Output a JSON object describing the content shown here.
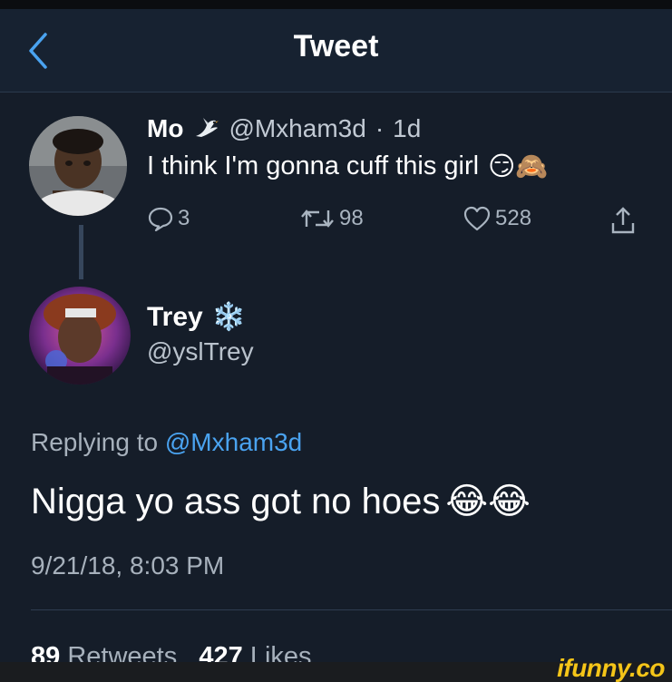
{
  "header": {
    "title": "Tweet"
  },
  "original_tweet": {
    "name": "Mo",
    "handle": "@Mxham3d",
    "separator": "·",
    "age": "1d",
    "text": "I think I'm gonna cuff this girl",
    "emoji": "😏🙈",
    "replies": "3",
    "retweets": "98",
    "likes": "528"
  },
  "reply_tweet": {
    "name": "Trey",
    "emoji_name": "❄️",
    "handle": "@yslTrey",
    "replying_prefix": "Replying to",
    "replying_handle": "@Mxham3d",
    "text": "Nigga yo ass got no hoes",
    "text_emoji": "😂😂",
    "timestamp": "9/21/18, 8:03 PM",
    "retweets_count": "89",
    "retweets_label": "Retweets",
    "likes_count": "427",
    "likes_label": "Likes"
  },
  "watermark": {
    "text": "ifunny.co"
  },
  "colors": {
    "background": "#151d29",
    "accent_link": "#4aa3f0",
    "muted_text": "#a7b1bc",
    "watermark": "#f5c518"
  }
}
